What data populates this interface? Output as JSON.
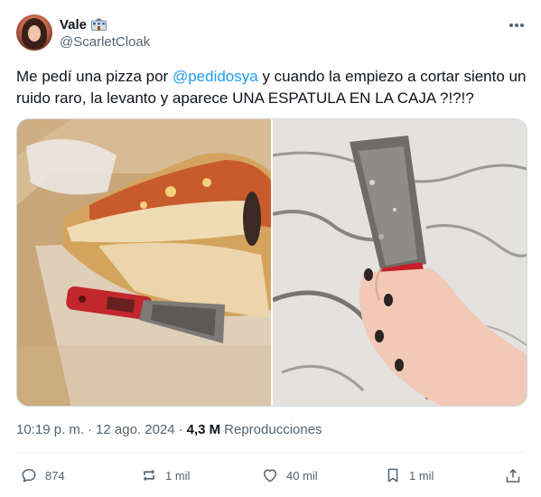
{
  "user": {
    "display_name": "Vale",
    "handle": "@ScarletCloak",
    "badge_icon": "school-building-icon"
  },
  "tweet": {
    "text_before": "Me pedí una pizza por ",
    "mention": "@pedidosya",
    "text_after": " y cuando la empiezo a cortar siento un ruido raro, la levanto y aparece UNA ESPATULA EN LA CAJA ?!?!?",
    "time": "10:19 p. m.",
    "separator": "·",
    "date": "12 ago. 2024",
    "views_count": "4,3 M",
    "views_label": "Reproducciones"
  },
  "media": [
    {
      "name": "pizza-box-photo",
      "icon": "pizza-with-spatula-photo"
    },
    {
      "name": "spatula-hand-photo",
      "icon": "hand-holding-spatula-photo"
    }
  ],
  "actions": {
    "replies": "874",
    "reposts": "1 mil",
    "likes": "40 mil",
    "bookmarks": "1 mil"
  },
  "colors": {
    "link": "#1d9bf0",
    "secondary_text": "#536471",
    "primary_text": "#0f1419"
  }
}
